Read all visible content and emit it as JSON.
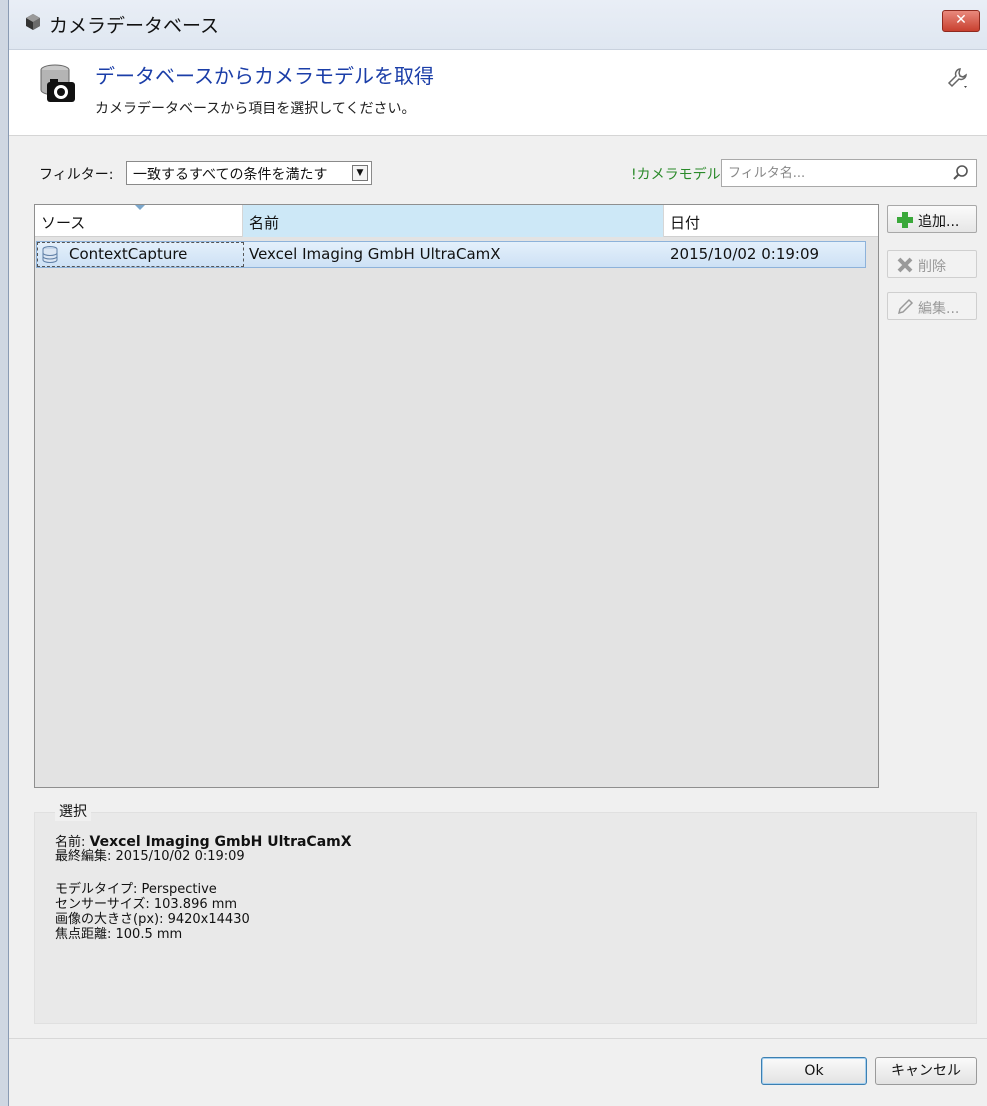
{
  "window": {
    "title": "カメラデータベース",
    "close_label": "✕"
  },
  "header": {
    "title": "データベースからカメラモデルを取得",
    "subtitle": "カメラデータベースから項目を選択してください。"
  },
  "filter": {
    "label": "フィルター:",
    "select_value": "一致するすべての条件を満たす",
    "camera_model_label": "!カメラモデル",
    "search_placeholder": "フィルタ名..."
  },
  "table": {
    "columns": [
      "ソース",
      "名前",
      "日付"
    ],
    "rows": [
      {
        "source": "ContextCapture",
        "name": "Vexcel Imaging GmbH UltraCamX",
        "date": "2015/10/02 0:19:09"
      }
    ]
  },
  "side_buttons": {
    "add": "追加...",
    "delete": "削除",
    "edit": "編集..."
  },
  "selection": {
    "title": "選択",
    "name_label": "名前:",
    "name_value": "Vexcel Imaging GmbH UltraCamX",
    "last_edit": "最終編集: 2015/10/02 0:19:09",
    "model_type": "モデルタイプ: Perspective",
    "sensor_size": "センサーサイズ: 103.896 mm",
    "image_size": "画像の大きさ(px): 9420x14430",
    "focal_length": "焦点距離: 100.5 mm"
  },
  "footer": {
    "ok": "Ok",
    "cancel": "キャンセル"
  },
  "colors": {
    "header_title": "#1b3ea8",
    "camera_model_label": "#2a8a2a",
    "close": "#c8402f"
  },
  "icons": [
    "camera-db-icon",
    "wrench-icon",
    "search-icon",
    "database-icon",
    "plus-icon",
    "delete-x-icon",
    "pencil-icon",
    "close-icon"
  ]
}
